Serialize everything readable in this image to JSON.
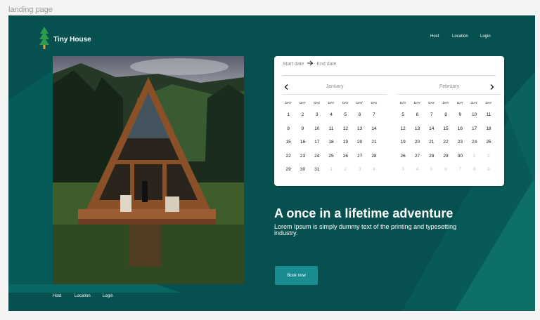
{
  "canvas_label": "landing page",
  "brand": {
    "name": "Tiny House",
    "logo_icon": "pine-tree-icon"
  },
  "header_nav": [
    {
      "label": "Host"
    },
    {
      "label": "Location"
    },
    {
      "label": "Login"
    }
  ],
  "hero_image": {
    "subject": "a-frame-cabin-photo"
  },
  "calendar": {
    "start_placeholder": "Start date",
    "end_placeholder": "End date",
    "arrow_icon": "arrow-right-icon",
    "prev_icon": "chevron-left-icon",
    "next_icon": "chevron-right-icon",
    "weekday_label": "DAY",
    "months": [
      {
        "name": "January",
        "weeks": [
          [
            "1",
            "2",
            "3",
            "4",
            "5",
            "6",
            "7"
          ],
          [
            "8",
            "9",
            "10",
            "11",
            "12",
            "13",
            "14"
          ],
          [
            "15",
            "16",
            "17",
            "18",
            "19",
            "20",
            "21"
          ],
          [
            "22",
            "23",
            "24",
            "25",
            "26",
            "27",
            "28"
          ],
          [
            "29",
            "30",
            "31",
            "1",
            "2",
            "3",
            "4"
          ]
        ],
        "trailing_muted": 4
      },
      {
        "name": "February",
        "weeks": [
          [
            "5",
            "6",
            "7",
            "8",
            "9",
            "10",
            "11"
          ],
          [
            "12",
            "13",
            "14",
            "15",
            "16",
            "17",
            "18"
          ],
          [
            "19",
            "20",
            "21",
            "22",
            "23",
            "24",
            "25"
          ],
          [
            "26",
            "27",
            "28",
            "29",
            "30",
            "1",
            "2"
          ],
          [
            "3",
            "4",
            "5",
            "6",
            "7",
            "8",
            "9"
          ]
        ],
        "trailing_muted": 9
      }
    ]
  },
  "hero": {
    "title": "A once in a lifetime adventure",
    "text": "Lorem Ipsum is simply dummy text of the printing and typesetting industry.",
    "cta": "Book now"
  },
  "footer_nav": [
    {
      "label": "Host"
    },
    {
      "label": "Location"
    },
    {
      "label": "Login"
    }
  ],
  "colors": {
    "background": "#06514f",
    "accent_button": "#1a8d92",
    "card": "#ffffff",
    "tree": "#2e9a4c"
  }
}
